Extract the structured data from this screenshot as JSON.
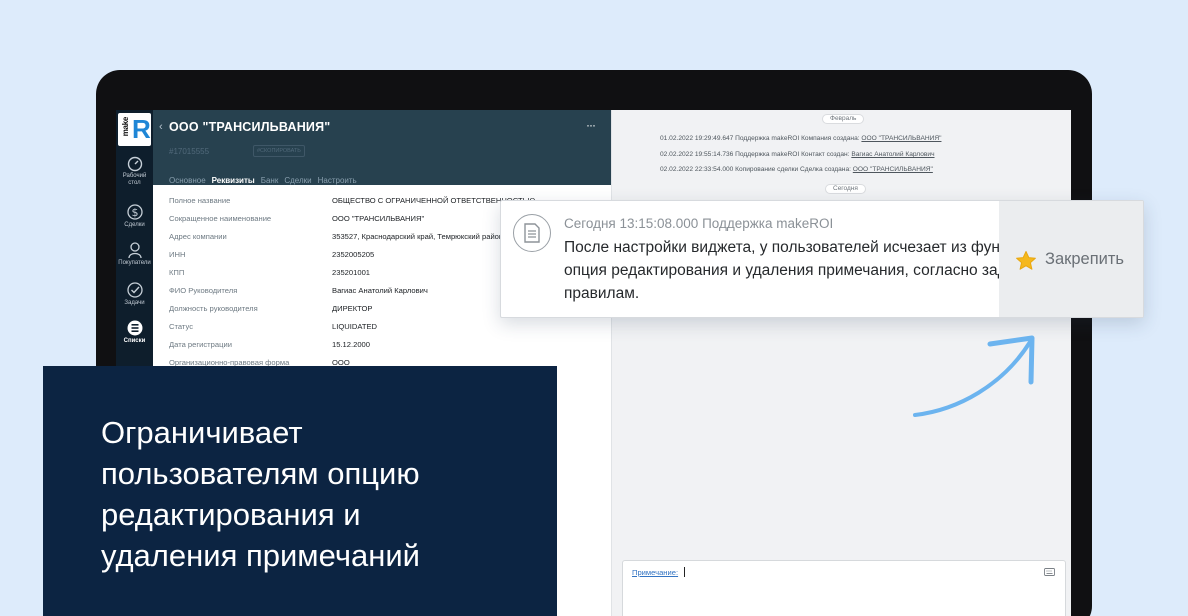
{
  "app": {
    "logo_text": "make",
    "logo_letter": "R",
    "nav": [
      {
        "label": "Рабочий стол",
        "icon": "gauge-icon"
      },
      {
        "label": "Сделки",
        "icon": "dollar-icon"
      },
      {
        "label": "Покупатели",
        "icon": "person-icon"
      },
      {
        "label": "Задачи",
        "icon": "checkmark-icon"
      },
      {
        "label": "Списки",
        "icon": "list-icon",
        "active": true
      }
    ]
  },
  "header": {
    "back_icon": "‹",
    "title": "ООО \"ТРАНСИЛЬВАНИЯ\"",
    "more_icon": "···",
    "deal_id": "#17015555",
    "copy_label": "#СКОПИРОВАТЬ",
    "tabs": [
      "Основное",
      "Реквизиты",
      "Банк",
      "Сделки",
      "Настроить"
    ],
    "active_tab": "Реквизиты"
  },
  "details": [
    {
      "label": "Полное название",
      "value": "ОБЩЕСТВО С ОГРАНИЧЕННОЙ ОТВЕТСТВЕННОСТЬЮ"
    },
    {
      "label": "Сокращенное наименование",
      "value": "ООО \"ТРАНСИЛЬВАНИЯ\""
    },
    {
      "label": "Адрес компании",
      "value": "353527, Краснодарский край, Темрюкский район"
    },
    {
      "label": "ИНН",
      "value": "2352005205"
    },
    {
      "label": "КПП",
      "value": "235201001"
    },
    {
      "label": "ФИО Руководителя",
      "value": "Вагиас Анатолий Карлович"
    },
    {
      "label": "Должность руководителя",
      "value": "ДИРЕКТОР"
    },
    {
      "label": "Статус",
      "value": "LIQUIDATED"
    },
    {
      "label": "Дата регистрации",
      "value": "15.12.2000"
    },
    {
      "label": "Организационно-правовая форма",
      "value": "ООО"
    }
  ],
  "feed": {
    "month_label": "Февраль",
    "today_label": "Сегодня",
    "entries": [
      {
        "text": "01.02.2022 19:29:49.647 Поддержка makeROI Компания создана:",
        "link": "ООО \"ТРАНСИЛЬВАНИЯ\""
      },
      {
        "text": "02.02.2022 19:55:14.736 Поддержка makeROI Контакт создан:",
        "link": "Вагиас Анатолий Карлович"
      },
      {
        "text": "02.02.2022 22:33:54.000 Копирование сделки Сделка создана:",
        "link": "ООО \"ТРАНСИЛЬВАНИЯ\""
      }
    ],
    "note_label": "Примечание",
    "note_colon": ":"
  },
  "note_card": {
    "meta": "Сегодня 13:15:08.000 Поддержка makeROI",
    "lines": [
      "После настройки виджета, у пользователей исчезает из функций",
      "опция редактирования и удаления примечания, согласно заданным",
      "правилам."
    ],
    "pin_label": "Закрепить",
    "pin_icon": "star-icon",
    "icon": "document-icon"
  },
  "caption": {
    "lines": [
      "Ограничивает",
      "пользователям опцию",
      "редактирования и",
      "удаления примечаний"
    ]
  },
  "colors": {
    "background": "#ddebfb",
    "header": "#27414f",
    "nav": "#0e1e2c",
    "caption_panel": "#0c2442",
    "accent_star": "#f5b81c",
    "arrow": "#6cb4ef"
  }
}
